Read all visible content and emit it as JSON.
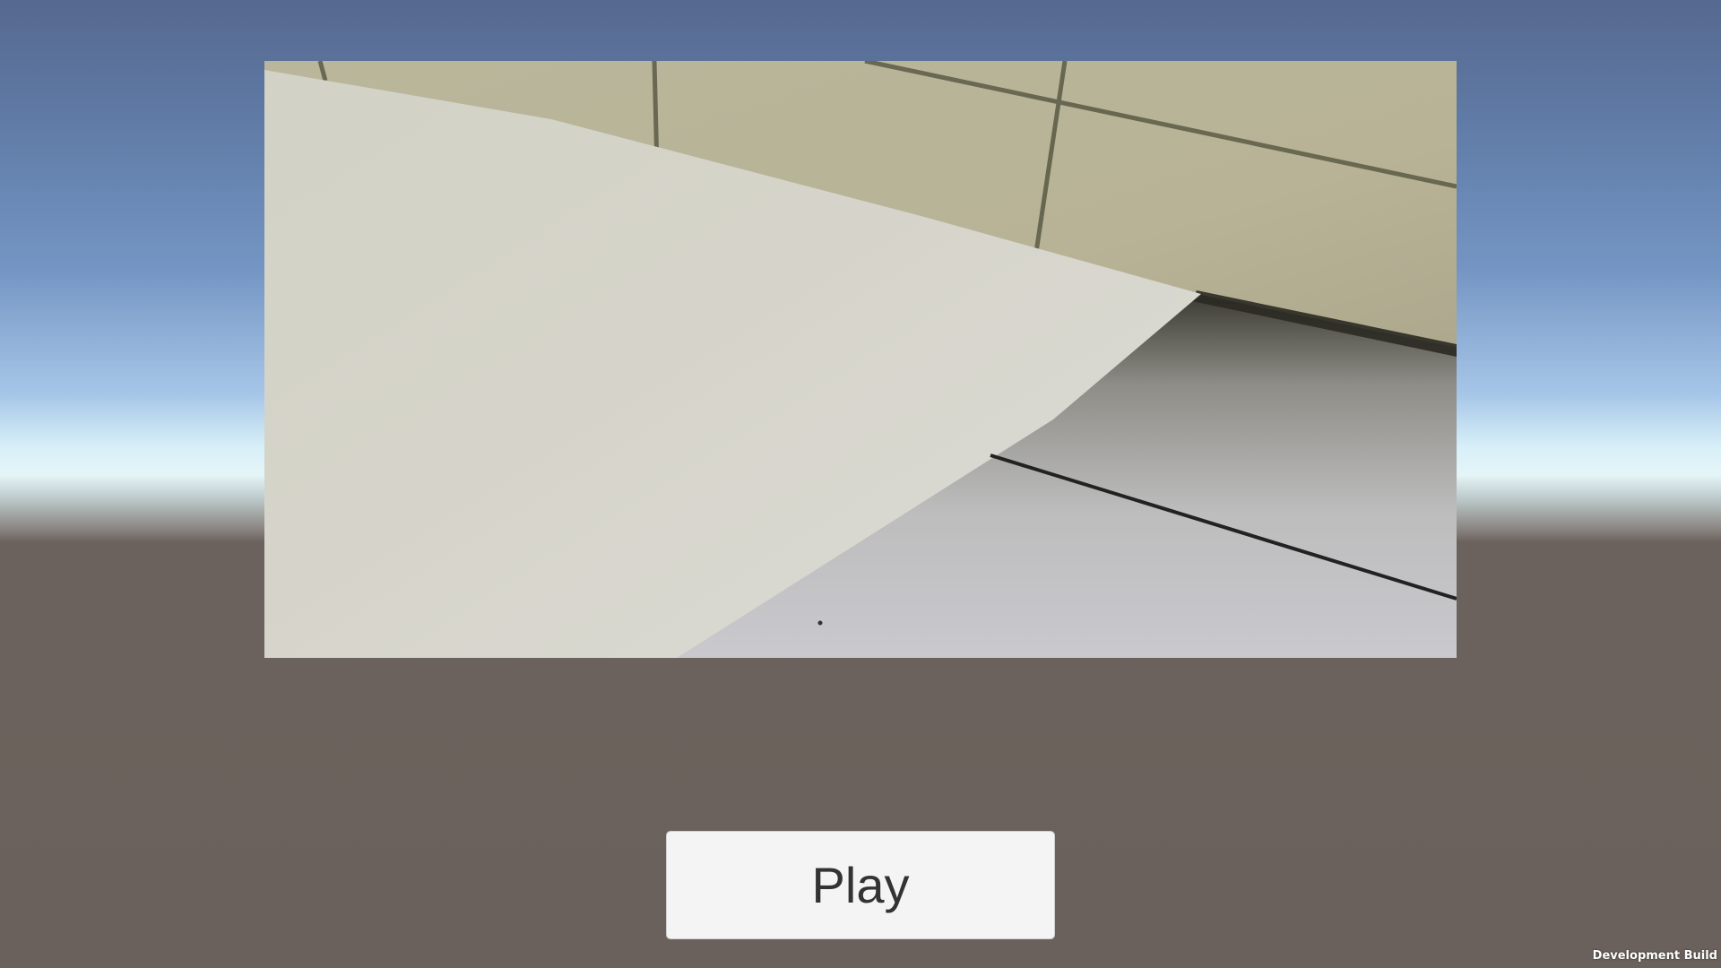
{
  "main_menu": {
    "play_label": "Play"
  },
  "footer": {
    "build_label": "Development Build"
  },
  "colors": {
    "sky_top": "#56698f",
    "horizon": "#e4f5f8",
    "ground": "#6a615c",
    "button_bg": "#f4f4f4",
    "button_text": "#333333"
  }
}
